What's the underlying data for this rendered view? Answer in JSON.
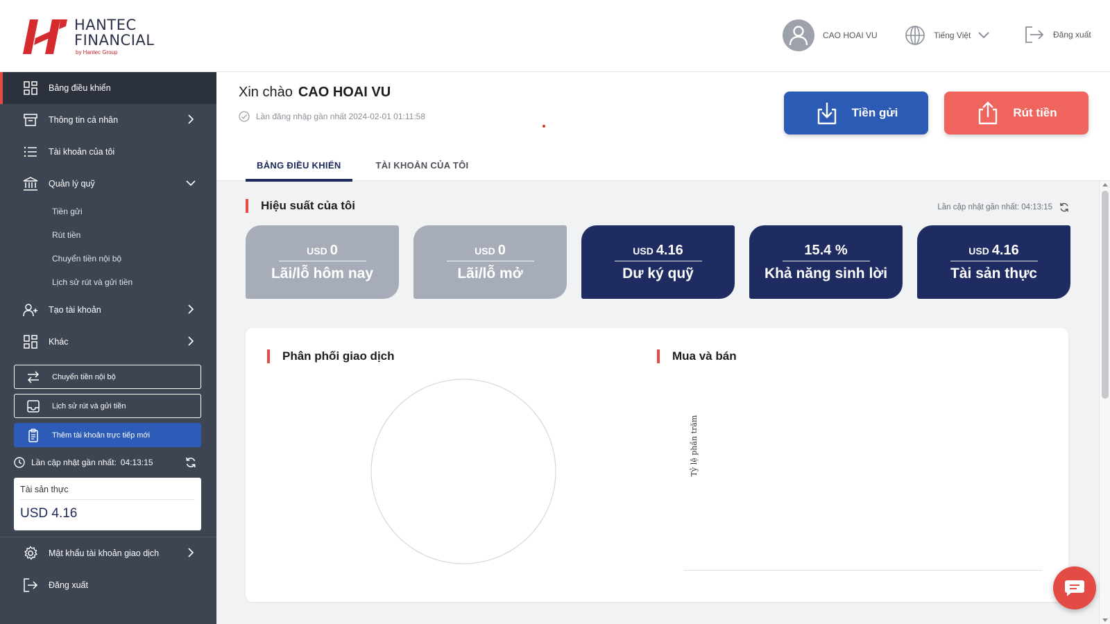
{
  "header": {
    "logo_line1": "HANTEC",
    "logo_line2": "FINANCIAL",
    "logo_sub": "by Hantec Group",
    "user_name": "CAO HOAI VU",
    "language": "Tiếng Việt",
    "logout": "Đăng xuất"
  },
  "sidebar": {
    "items": [
      {
        "label": "Bảng điều khiển",
        "icon": "grid-icon"
      },
      {
        "label": "Thông tin cá nhân",
        "icon": "archive-icon"
      },
      {
        "label": "Tài khoản của tôi",
        "icon": "list-icon"
      },
      {
        "label": "Quản lý quỹ",
        "icon": "bank-icon"
      },
      {
        "label": "Tạo tài khoản",
        "icon": "user-plus-icon"
      },
      {
        "label": "Khác",
        "icon": "grid-icon"
      }
    ],
    "sub_items": [
      "Tiền gửi",
      "Rút tiền",
      "Chuyển tiền nội bộ",
      "Lịch sử rút và gửi tiền"
    ],
    "buttons": [
      {
        "label": "Chuyển tiền nội bộ",
        "icon": "transfer-icon"
      },
      {
        "label": "Lịch sử rút và gửi tiền",
        "icon": "inbox-icon"
      },
      {
        "label": "Thêm tài khoản trực tiếp mới",
        "icon": "clipboard-icon"
      }
    ],
    "update_label": "Lần cập nhật gần nhất:",
    "update_time": "04:13:15",
    "asset_label": "Tài sản thực",
    "asset_value": "USD 4.16",
    "bottom_items": [
      {
        "label": "Mật khẩu tài khoản giao dịch",
        "icon": "gear-icon"
      },
      {
        "label": "Đăng xuất",
        "icon": "logout-icon"
      }
    ]
  },
  "main": {
    "greeting_prefix": "Xin chào",
    "greeting_name": "CAO HOAI VU",
    "last_login": "Lần đăng nhập gần nhất 2024-02-01 01:11:58",
    "deposit_label": "Tiền gửi",
    "withdraw_label": "Rút tiền",
    "tabs": [
      "BẢNG ĐIỀU KHIỂN",
      "TÀI KHOẢN CỦA TÔI"
    ]
  },
  "performance": {
    "title": "Hiệu suất của tôi",
    "update_text": "Lần cập nhật gần nhất: 04:13:15",
    "cards": [
      {
        "currency": "USD",
        "value": "0",
        "label": "Lãi/lỗ hôm nay",
        "style": "grey"
      },
      {
        "currency": "USD",
        "value": "0",
        "label": "Lãi/lỗ mở",
        "style": "grey"
      },
      {
        "currency": "USD",
        "value": "4.16",
        "label": "Dư ký quỹ",
        "style": "navy"
      },
      {
        "currency": "",
        "value": "15.4 %",
        "label": "Khả năng sinh lời",
        "style": "navy"
      },
      {
        "currency": "USD",
        "value": "4.16",
        "label": "Tài sản thực",
        "style": "navy"
      }
    ]
  },
  "charts": {
    "distribution_title": "Phân phối giao dịch",
    "buysell_title": "Mua và bán",
    "ylabel": "Tỷ lệ phần trăm"
  },
  "colors": {
    "navy": "#1f2c62",
    "accent_red": "#e34b44",
    "deposit_blue": "#2b5bb5",
    "withdraw_red": "#ef645c",
    "sidebar_bg": "#3d4452"
  }
}
